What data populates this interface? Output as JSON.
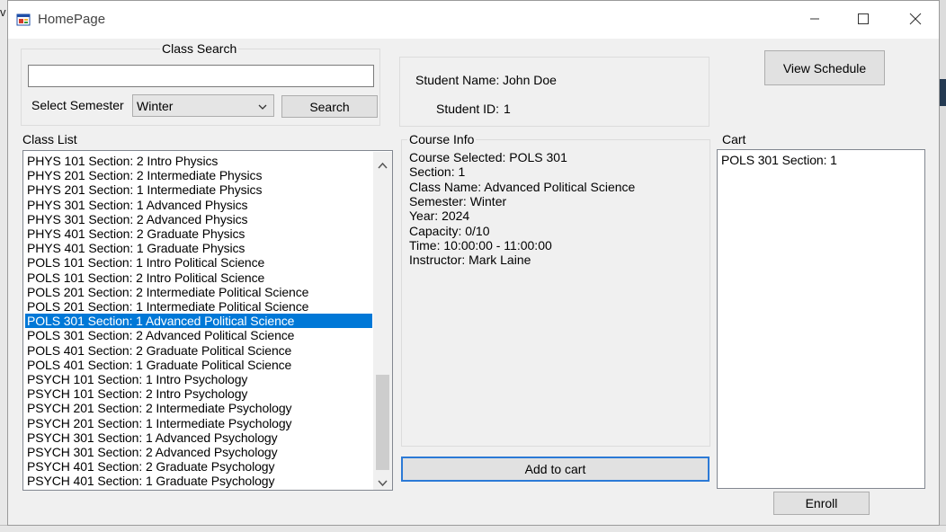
{
  "window": {
    "title": "HomePage"
  },
  "class_search": {
    "group_title": "Class Search",
    "search_value": "",
    "semester_label": "Select Semester",
    "semester_selected": "Winter",
    "search_button": "Search"
  },
  "student": {
    "name_label": "Student Name:",
    "name_value": "John Doe",
    "id_label": "Student ID:",
    "id_value": "1"
  },
  "view_schedule_button": "View Schedule",
  "class_list": {
    "label": "Class List",
    "selected_index": 11,
    "items": [
      "PHYS 101 Section: 2 Intro Physics",
      "PHYS 201 Section: 2 Intermediate Physics",
      "PHYS 201 Section: 1 Intermediate Physics",
      "PHYS 301 Section: 1 Advanced Physics",
      "PHYS 301 Section: 2 Advanced Physics",
      "PHYS 401 Section: 2 Graduate Physics",
      "PHYS 401 Section: 1 Graduate Physics",
      "POLS 101 Section: 1 Intro Political Science",
      "POLS 101 Section: 2 Intro Political Science",
      "POLS 201 Section: 2 Intermediate Political Science",
      "POLS 201 Section: 1 Intermediate Political Science",
      "POLS 301 Section: 1 Advanced Political Science",
      "POLS 301 Section: 2 Advanced Political Science",
      "POLS 401 Section: 2 Graduate Political Science",
      "POLS 401 Section: 1 Graduate Political Science",
      "PSYCH 101 Section: 1 Intro Psychology",
      "PSYCH 101 Section: 2 Intro Psychology",
      "PSYCH 201 Section: 2 Intermediate Psychology",
      "PSYCH 201 Section: 1 Intermediate Psychology",
      "PSYCH 301 Section: 1 Advanced Psychology",
      "PSYCH 301 Section: 2 Advanced Psychology",
      "PSYCH 401 Section: 2 Graduate Psychology",
      "PSYCH 401 Section: 1 Graduate Psychology"
    ]
  },
  "course_info": {
    "group_title": "Course Info",
    "course_selected": "Course Selected:  POLS 301",
    "section": "Section:  1",
    "class_name": "Class Name:  Advanced Political Science",
    "semester": "Semester: Winter",
    "year": "Year:  2024",
    "capacity": "Capacity:  0/10",
    "time": "Time:  10:00:00 - 11:00:00",
    "instructor": "Instructor: Mark Laine"
  },
  "add_to_cart_button": "Add to cart",
  "cart": {
    "label": "Cart",
    "items": [
      "POLS 301 Section: 1"
    ]
  },
  "enroll_button": "Enroll",
  "background": {
    "left_edge_text": "v"
  },
  "colors": {
    "selection": "#0078d7",
    "focus_border": "#2c7ad6"
  },
  "icons": {
    "app": "app-icon",
    "minimize": "minimize-icon",
    "maximize": "maximize-icon",
    "close": "close-icon",
    "dropdown": "chevron-down-icon",
    "scroll_up": "scroll-up-icon",
    "scroll_down": "scroll-down-icon"
  }
}
